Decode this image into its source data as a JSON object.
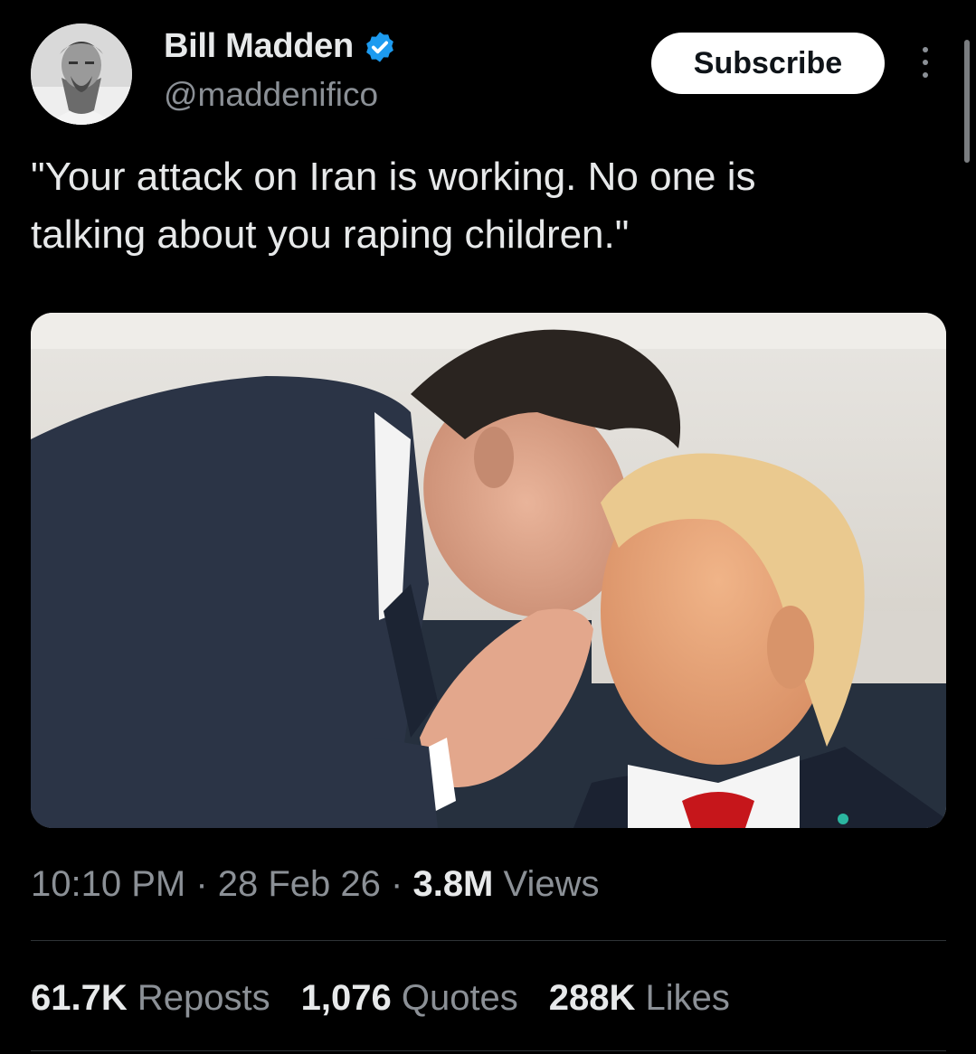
{
  "author": {
    "display_name": "Bill Madden",
    "handle": "@maddenifico",
    "verified_icon": "verified-badge-icon",
    "avatar_icon": "avatar"
  },
  "actions": {
    "subscribe_label": "Subscribe",
    "more_icon": "more-vertical-icon"
  },
  "tweet": {
    "text": "\"Your attack on Iran is working. No one is\ntalking about you raping children.\""
  },
  "meta": {
    "time": "10:10 PM",
    "sep1": " · ",
    "date": "28 Feb 26",
    "sep2": " · ",
    "views_count": "3.8M",
    "views_label": " Views"
  },
  "stats": {
    "reposts_count": "61.7K",
    "reposts_label": " Reposts",
    "quotes_count": "1,076",
    "quotes_label": " Quotes",
    "likes_count": "288K",
    "likes_label": " Likes"
  },
  "colors": {
    "background": "#000000",
    "text": "#e7e9ea",
    "muted": "#8b9096",
    "verified": "#1d9bf0",
    "button_bg": "#ffffff"
  }
}
